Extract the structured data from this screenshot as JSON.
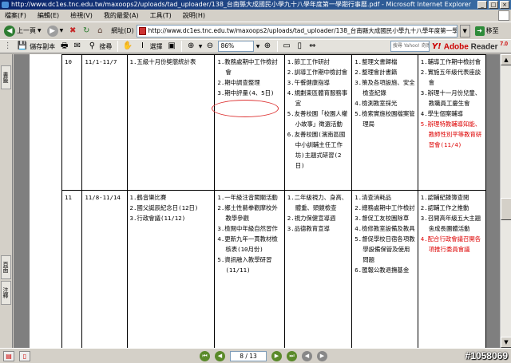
{
  "window": {
    "title": "http://www.dc1es.tnc.edu.tw/maxoops2/uploads/tad_uploader/138_台南縣大成國民小學九十八學年度第一學期行事曆.pdf - Microsoft Internet Explorer",
    "controls": [
      "_",
      "□",
      "×"
    ]
  },
  "menu": [
    "檔案(F)",
    "編輯(E)",
    "檢視(V)",
    "我的最愛(A)",
    "工具(T)",
    "說明(H)"
  ],
  "navbar": {
    "back_label": "上一頁",
    "address_label": "網址(D)",
    "address_value": "http://www.dc1es.tnc.edu.tw/maxoops2/uploads/tad_uploader/138_台南縣大成國民小學九十八學年度第一學期行事曆.pdf",
    "go_label": "移至"
  },
  "adobe": {
    "save_label": "儲存副本",
    "search_label": "搜尋",
    "select_label": "選擇",
    "zoom_value": "86%",
    "search_placeholder": "搜尋 Yahoo! 奇摩網路",
    "yahoo_label": "Y!",
    "brand": "Adobe",
    "product": "Reader",
    "version": "7.0"
  },
  "left_tabs": [
    "書籤",
    "頁面",
    "注釋"
  ],
  "status": {
    "page_indicator": "8 / 13"
  },
  "watermark": "#1058069",
  "table": {
    "rows": [
      {
        "week": "10",
        "dates": "11/1-11/7",
        "col1": [
          "1.五級十月份獎懲統計表"
        ],
        "col2": [
          "1.教務處期中工作檢討會",
          "2.期中調查整理",
          "3.期中評量(4、5日)"
        ],
        "col3": [
          "1.節工工作研討",
          "2.訓導工作期中檢討會",
          "3.午餐健康指導",
          "4.規劃東區體育服務事宜",
          "5.友善校園「校園人權小故事」徵選活動",
          "6.友善校園(濱南區國中小訓輔主任工作坊)主題式研習(2日)"
        ],
        "col4": [
          "1.整理文書歸檔",
          "2.整理會計書籍",
          "3.策及各項設施、安全檢查紀錄",
          "4.檢測教室採光",
          "5.檢索實施校園檔案管理局"
        ],
        "col5": [
          "1.輔導工作期中檢討會",
          "2.實施五年級代表座談會",
          "3.辦理十一月份兒童、教職員工慶生會",
          "4.學生個案輔導"
        ],
        "col5_red": [
          "5.辦理特教輔導知能、教師性別平等教育研習會(11/4)"
        ]
      },
      {
        "week": "11",
        "dates": "11/8-11/14",
        "col1": [
          "1.鶴音樂比賽",
          "2.國父誕辰紀念日(12日)",
          "3.行政會議(11/12)"
        ],
        "col2": [
          "1.一年級注音闖關活動",
          "2.鄉土性藝拳觀摩校外教學參觀",
          "3.檢閱中年級自然習作",
          "4.更新九年一貫教材檢核表(10月份)",
          "5.資訊融入教學研習(11/11)"
        ],
        "col3": [
          "1.二年級視力、身高、體重、頭鏡檢查",
          "2.視力保健宣導週",
          "3.品德教育宣導"
        ],
        "col4": [
          "1.清查消耗品",
          "2.總務處期中工作檢討",
          "3.督促工友校園除草",
          "4.檢修教室設備及教具",
          "5.督促學校日宿各項教學設備保管及使用問題",
          "6.匯報公教退撫基金"
        ],
        "col5": [
          "1.認輔紀錄簿查閱",
          "2.認輔工作之推動",
          "3.召開高年級五大主題舍成長團體活動"
        ],
        "col5_red": [
          "4.配合行政會議召開各項推行委員會議"
        ]
      }
    ]
  }
}
